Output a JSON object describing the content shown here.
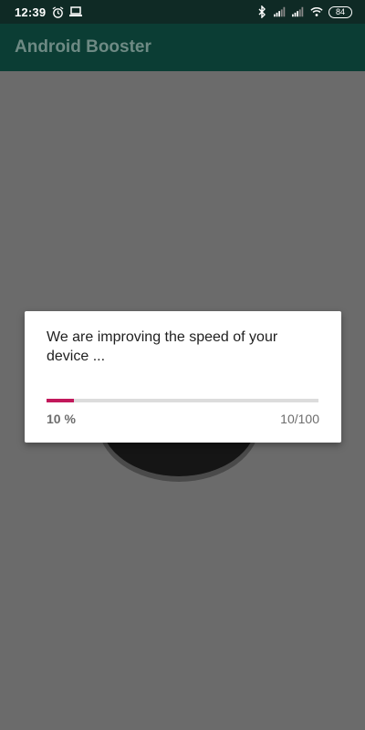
{
  "status_bar": {
    "time": "12:39",
    "icons_left": [
      "alarm-icon",
      "laptop-icon"
    ],
    "icons_right": [
      "bluetooth-icon",
      "signal-icon",
      "signal-icon",
      "wifi-icon"
    ],
    "battery": "84"
  },
  "app_bar": {
    "title": "Android Booster"
  },
  "dialog": {
    "message": "We are improving the speed of your device ...",
    "progress_percent_label": "10 %",
    "progress_count_label": "10/100",
    "progress_value": 10,
    "progress_max": 100
  },
  "colors": {
    "status_bar": "#0f2a25",
    "app_bar": "#0b3d34",
    "scrim": "#6b6b6b",
    "accent": "#c2185b"
  }
}
